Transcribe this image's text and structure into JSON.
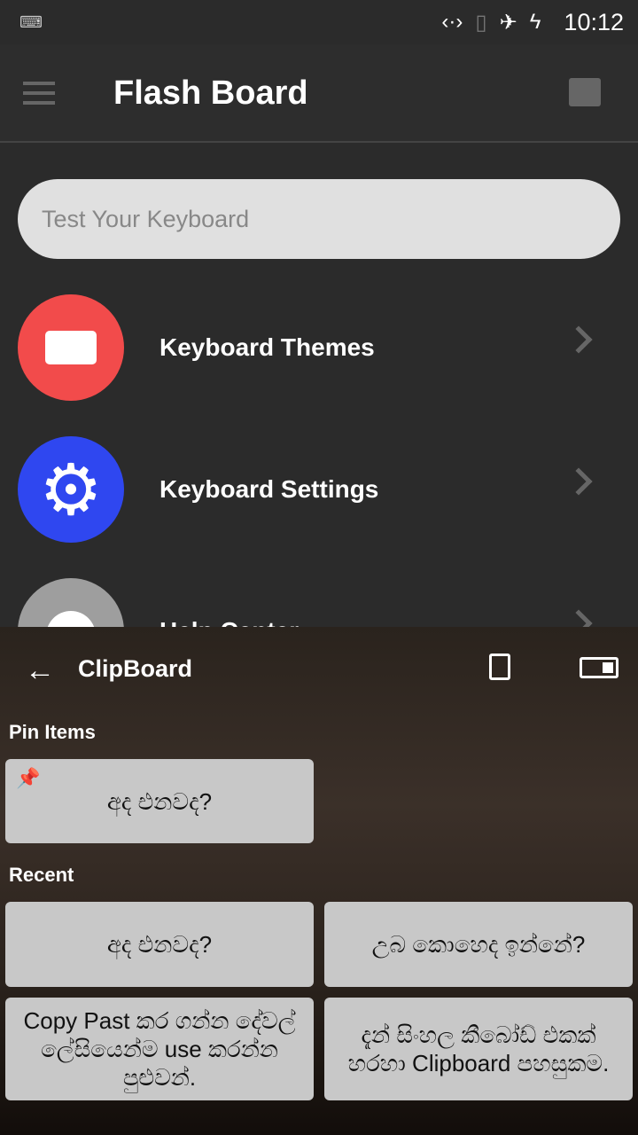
{
  "status": {
    "time": "10:12",
    "icons": [
      "keyboard-icon",
      "data-transfer-icon",
      "no-sim-icon",
      "airplane-icon",
      "battery-charging-icon"
    ]
  },
  "appbar": {
    "title": "Flash Board"
  },
  "search": {
    "placeholder": "Test Your Keyboard"
  },
  "menu": [
    {
      "label": "Keyboard Themes",
      "color": "#f24b4b",
      "icon": "keyboard-icon"
    },
    {
      "label": "Keyboard Settings",
      "color": "#2f47f0",
      "icon": "gear-icon"
    },
    {
      "label": "Help Center",
      "color": "#9e9e9e",
      "icon": "info-icon"
    }
  ],
  "clipboard": {
    "title": "ClipBoard",
    "pin_heading": "Pin Items",
    "recent_heading": "Recent",
    "pinned": [
      "අද එනවද?"
    ],
    "recent": [
      "අද එනවද?",
      "උබ කොහෙද ඉන්නේ?",
      "Copy Past කර ගන්න දේවල් ලේසියෙන්ම use කරන්න පුළුවන්.",
      "දැන් සිංහල කීබෝඩ් එකක් හරහා Clipboard පහසුකම."
    ]
  }
}
